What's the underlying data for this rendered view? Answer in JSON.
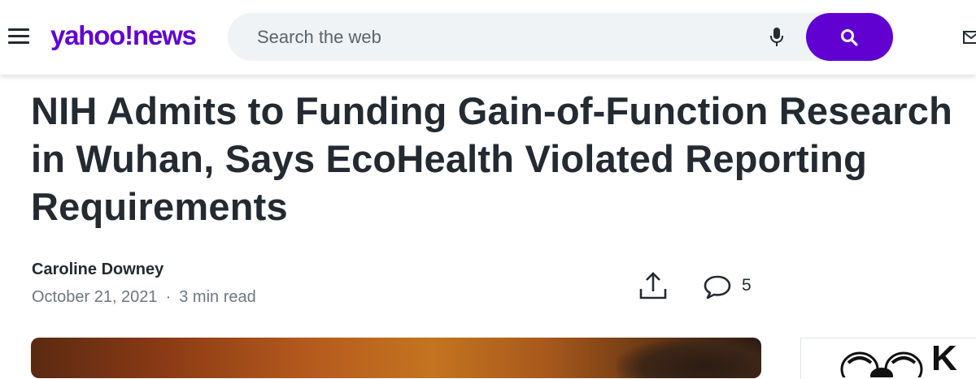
{
  "header": {
    "logo_brand": "yahoo!",
    "logo_section": "news",
    "search_placeholder": "Search the web",
    "icons": {
      "menu": "hamburger-menu-icon",
      "mic": "microphone-icon",
      "search": "magnifier-icon",
      "mail": "mail-icon"
    },
    "accent_color": "#6001d2"
  },
  "article": {
    "title": "NIH Admits to Funding Gain-of-Function Research in Wuhan, Says EcoHealth Violated Reporting Requirements",
    "author": "Caroline Downey",
    "date": "October 21, 2021",
    "separator": "·",
    "read_time": "3 min read",
    "comment_count": "5",
    "icons": {
      "share": "share-icon",
      "comment": "comment-icon"
    }
  },
  "ad": {
    "visible_letter": "K"
  }
}
